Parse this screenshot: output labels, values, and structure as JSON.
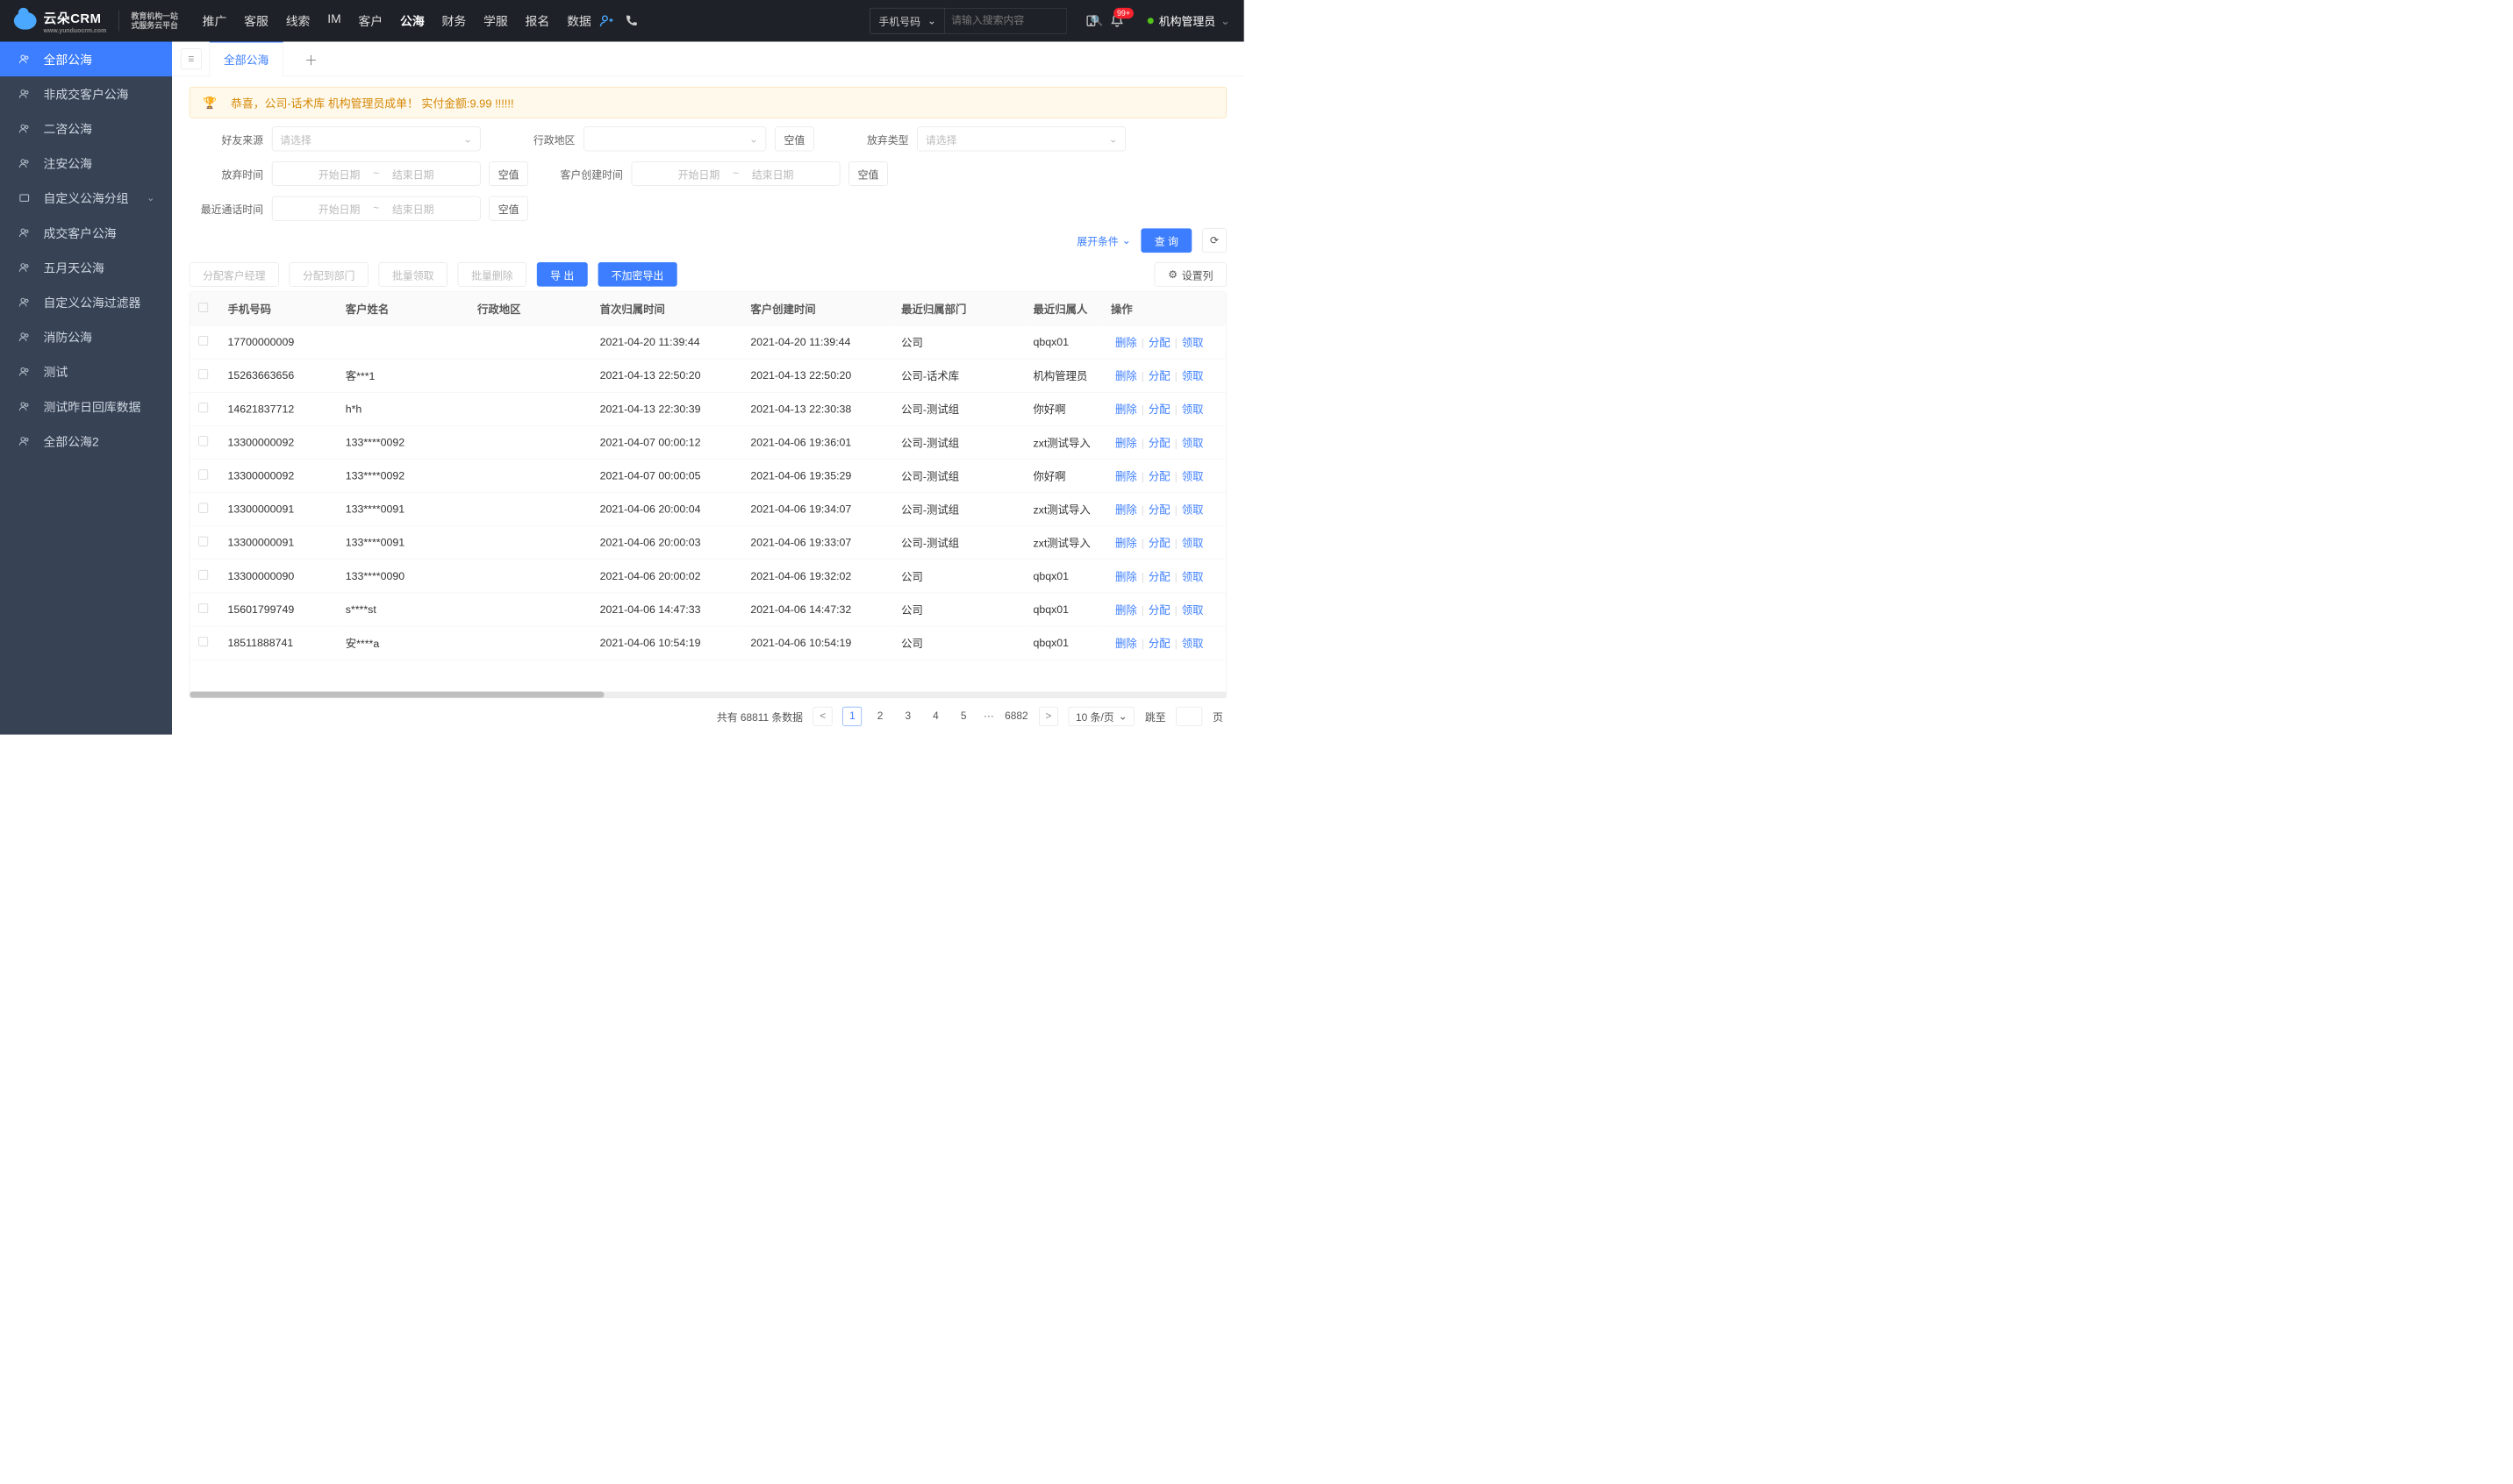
{
  "nav": {
    "logo_main": "云朵CRM",
    "logo_sub1": "教育机构一站",
    "logo_sub2": "式服务云平台",
    "logo_domain": "www.yunduocrm.com",
    "items": [
      "推广",
      "客服",
      "线索",
      "IM",
      "客户",
      "公海",
      "财务",
      "学服",
      "报名",
      "数据"
    ],
    "active_index": 5,
    "search_type": "手机号码",
    "search_placeholder": "请输入搜索内容",
    "bell_badge": "99+",
    "user_name": "机构管理员"
  },
  "sidebar": {
    "items": [
      {
        "label": "全部公海",
        "icon": "users"
      },
      {
        "label": "非成交客户公海",
        "icon": "users"
      },
      {
        "label": "二咨公海",
        "icon": "users"
      },
      {
        "label": "注安公海",
        "icon": "users"
      },
      {
        "label": "自定义公海分组",
        "icon": "folder",
        "has_children": true
      },
      {
        "label": "成交客户公海",
        "icon": "users"
      },
      {
        "label": "五月天公海",
        "icon": "users"
      },
      {
        "label": "自定义公海过滤器",
        "icon": "users"
      },
      {
        "label": "消防公海",
        "icon": "users"
      },
      {
        "label": "测试",
        "icon": "users"
      },
      {
        "label": "测试昨日回库数据",
        "icon": "users"
      },
      {
        "label": "全部公海2",
        "icon": "users"
      }
    ],
    "active_index": 0
  },
  "tabs": {
    "active": "全部公海"
  },
  "banner": {
    "text": "恭喜，公司-话术库  机构管理员成单！  实付金额:9.99 !!!!!!"
  },
  "filters": {
    "source_label": "好友来源",
    "source_placeholder": "请选择",
    "region_label": "行政地区",
    "region_empty": "空值",
    "abandon_type_label": "放弃类型",
    "abandon_type_placeholder": "请选择",
    "abandon_time_label": "放弃时间",
    "abandon_time_empty": "空值",
    "create_time_label": "客户创建时间",
    "create_time_empty": "空值",
    "last_call_label": "最近通话时间",
    "last_call_empty": "空值",
    "date_start": "开始日期",
    "date_end": "结束日期",
    "expand": "展开条件",
    "query": "查 询"
  },
  "toolbar": {
    "assign_manager": "分配客户经理",
    "assign_dept": "分配到部门",
    "batch_claim": "批量领取",
    "batch_delete": "批量删除",
    "export": "导 出",
    "export_plain": "不加密导出",
    "column_setting": "设置列"
  },
  "table": {
    "headers": [
      "手机号码",
      "客户姓名",
      "行政地区",
      "首次归属时间",
      "客户创建时间",
      "最近归属部门",
      "最近归属人",
      "操作"
    ],
    "op": {
      "delete": "删除",
      "assign": "分配",
      "claim": "领取"
    },
    "rows": [
      {
        "phone": "17700000009",
        "name": "",
        "region": "",
        "first": "2021-04-20 11:39:44",
        "create": "2021-04-20 11:39:44",
        "dept": "公司",
        "owner": "qbqx01"
      },
      {
        "phone": "15263663656",
        "name": "客***1",
        "region": "",
        "first": "2021-04-13 22:50:20",
        "create": "2021-04-13 22:50:20",
        "dept": "公司-话术库",
        "owner": "机构管理员"
      },
      {
        "phone": "14621837712",
        "name": "h*h",
        "region": "",
        "first": "2021-04-13 22:30:39",
        "create": "2021-04-13 22:30:38",
        "dept": "公司-测试组",
        "owner": "你好啊"
      },
      {
        "phone": "13300000092",
        "name": "133****0092",
        "region": "",
        "first": "2021-04-07 00:00:12",
        "create": "2021-04-06 19:36:01",
        "dept": "公司-测试组",
        "owner": "zxt测试导入"
      },
      {
        "phone": "13300000092",
        "name": "133****0092",
        "region": "",
        "first": "2021-04-07 00:00:05",
        "create": "2021-04-06 19:35:29",
        "dept": "公司-测试组",
        "owner": "你好啊"
      },
      {
        "phone": "13300000091",
        "name": "133****0091",
        "region": "",
        "first": "2021-04-06 20:00:04",
        "create": "2021-04-06 19:34:07",
        "dept": "公司-测试组",
        "owner": "zxt测试导入"
      },
      {
        "phone": "13300000091",
        "name": "133****0091",
        "region": "",
        "first": "2021-04-06 20:00:03",
        "create": "2021-04-06 19:33:07",
        "dept": "公司-测试组",
        "owner": "zxt测试导入"
      },
      {
        "phone": "13300000090",
        "name": "133****0090",
        "region": "",
        "first": "2021-04-06 20:00:02",
        "create": "2021-04-06 19:32:02",
        "dept": "公司",
        "owner": "qbqx01"
      },
      {
        "phone": "15601799749",
        "name": "s****st",
        "region": "",
        "first": "2021-04-06 14:47:33",
        "create": "2021-04-06 14:47:32",
        "dept": "公司",
        "owner": "qbqx01"
      },
      {
        "phone": "18511888741",
        "name": "安****a",
        "region": "",
        "first": "2021-04-06 10:54:19",
        "create": "2021-04-06 10:54:19",
        "dept": "公司",
        "owner": "qbqx01"
      }
    ]
  },
  "pager": {
    "total_prefix": "共有 ",
    "total": "68811",
    "total_suffix": " 条数据",
    "pages": [
      "1",
      "2",
      "3",
      "4",
      "5"
    ],
    "ellipsis": "···",
    "last": "6882",
    "per": "10 条/页",
    "jump1": "跳至",
    "jump2": "页"
  }
}
